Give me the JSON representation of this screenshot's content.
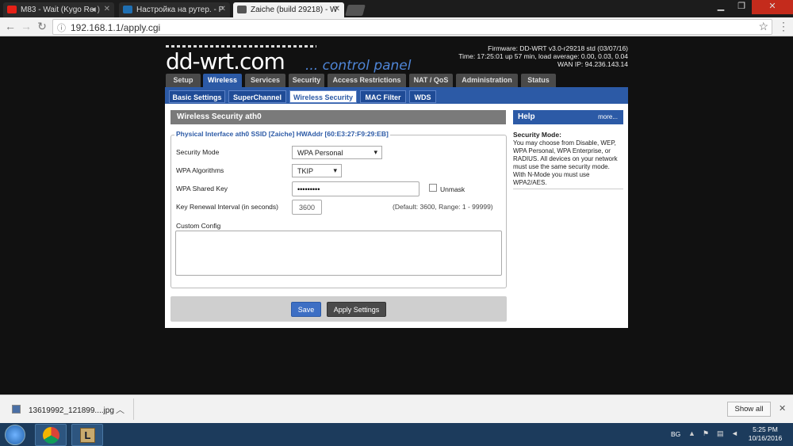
{
  "browser": {
    "tabs": [
      {
        "title": "M83 - Wait (Kygo Re",
        "icon": "youtube-icon",
        "color": "#e62117",
        "extra": "◄)"
      },
      {
        "title": "Настройка на рутер. - P",
        "icon": "forum-icon",
        "color": "#1f6fb2"
      },
      {
        "title": "Zaiche (build 29218) - W",
        "icon": "router-icon",
        "color": "#555"
      }
    ],
    "url": "192.168.1.1/apply.cgi"
  },
  "header": {
    "logo": "dd-wrt.com",
    "subtitle": "... control panel",
    "firmware": "Firmware: DD-WRT v3.0-r29218 std (03/07/16)",
    "time": "Time: 17:25:01 up 57 min, load average: 0.00, 0.03, 0.04",
    "wan": "WAN IP: 94.236.143.14"
  },
  "main_tabs": [
    "Setup",
    "Wireless",
    "Services",
    "Security",
    "Access Restrictions",
    "NAT / QoS",
    "Administration",
    "Status"
  ],
  "sub_tabs": [
    "Basic Settings",
    "SuperChannel",
    "Wireless Security",
    "MAC Filter",
    "WDS"
  ],
  "section": {
    "title": "Wireless Security ath0",
    "legend": "Physical Interface ath0 SSID [Zaiche] HWAddr [60:E3:27:F9:29:EB]",
    "security_mode_label": "Security Mode",
    "security_mode_value": "WPA Personal",
    "wpa_alg_label": "WPA Algorithms",
    "wpa_alg_value": "TKIP",
    "wpa_key_label": "WPA Shared Key",
    "wpa_key_value": "•••••••••",
    "unmask_label": "Unmask",
    "renewal_label": "Key Renewal Interval (in seconds)",
    "renewal_value": "3600",
    "renewal_hint": "(Default: 3600, Range: 1 - 99999)",
    "custom_config_label": "Custom Config"
  },
  "buttons": {
    "save": "Save",
    "apply": "Apply Settings"
  },
  "help": {
    "title": "Help",
    "more": "more...",
    "heading": "Security Mode:",
    "text": "You may choose from Disable, WEP, WPA Personal, WPA Enterprise, or RADIUS. All devices on your network must use the same security mode. With N-Mode you must use WPA2/AES."
  },
  "download": {
    "filename": "13619992_121899....jpg",
    "show_all": "Show all"
  },
  "taskbar": {
    "lang": "BG",
    "time": "5:25 PM",
    "date": "10/16/2016"
  }
}
